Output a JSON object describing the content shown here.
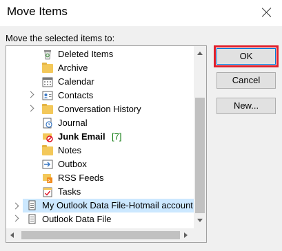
{
  "dialog": {
    "title": "Move Items",
    "prompt": "Move the selected items to:"
  },
  "tree": {
    "items": [
      {
        "label": "Deleted Items",
        "icon": "recycle-bin-icon"
      },
      {
        "label": "Archive",
        "icon": "folder-icon"
      },
      {
        "label": "Calendar",
        "icon": "calendar-icon"
      },
      {
        "label": "Contacts",
        "icon": "contacts-icon"
      },
      {
        "label": "Conversation History",
        "icon": "folder-icon"
      },
      {
        "label": "Journal",
        "icon": "journal-icon"
      },
      {
        "label": "Junk Email",
        "badge": "[7]",
        "icon": "junk-email-icon"
      },
      {
        "label": "Notes",
        "icon": "notes-icon"
      },
      {
        "label": "Outbox",
        "icon": "outbox-icon"
      },
      {
        "label": "RSS Feeds",
        "icon": "rss-icon"
      },
      {
        "label": "Tasks",
        "icon": "tasks-icon"
      },
      {
        "label": "My Outlook Data File-Hotmail account",
        "icon": "data-file-icon"
      },
      {
        "label": "Outlook Data File",
        "icon": "data-file-icon"
      }
    ]
  },
  "buttons": {
    "ok": "OK",
    "cancel": "Cancel",
    "new": "New..."
  },
  "colors": {
    "highlight": "#e0202c",
    "selection": "#cce8ff",
    "unread_badge": "#107c10"
  }
}
